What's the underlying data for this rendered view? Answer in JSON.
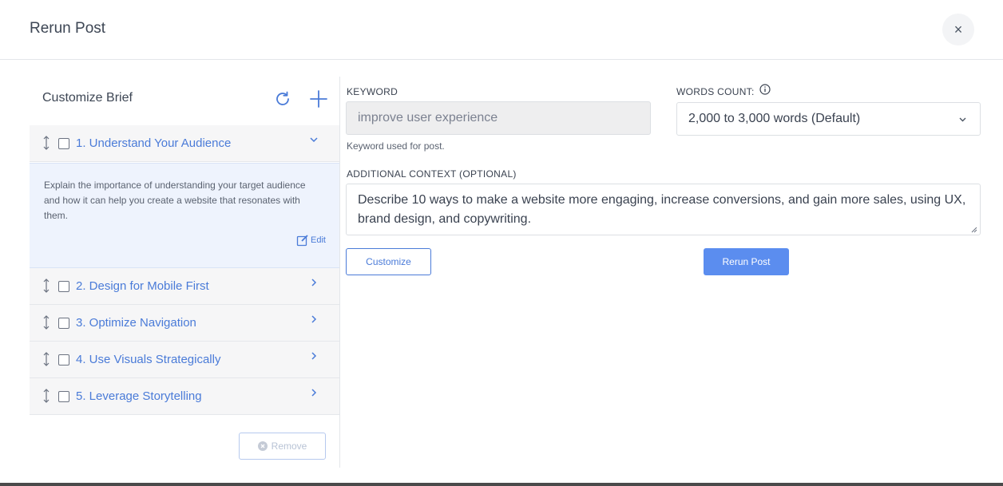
{
  "modal": {
    "title": "Rerun Post",
    "close_label": "×"
  },
  "brief": {
    "title": "Customize Brief",
    "items": [
      {
        "label": "1. Understand Your Audience",
        "expanded": true
      },
      {
        "label": "2. Design for Mobile First",
        "expanded": false
      },
      {
        "label": "3. Optimize Navigation",
        "expanded": false
      },
      {
        "label": "4. Use Visuals Strategically",
        "expanded": false
      },
      {
        "label": "5. Leverage Storytelling",
        "expanded": false
      }
    ],
    "detail_text": "Explain the importance of understanding your target audience and how it can help you create a website that resonates with them.",
    "edit_label": "Edit",
    "remove_label": "Remove"
  },
  "form": {
    "keyword_label": "KEYWORD",
    "keyword_value": "improve user experience",
    "keyword_help": "Keyword used for post.",
    "words_label": "WORDS COUNT:",
    "words_value": "2,000 to 3,000 words (Default)",
    "context_label": "ADDITIONAL CONTEXT (OPTIONAL)",
    "context_value": "Describe 10 ways to make a website more engaging, increase conversions, and gain more sales, using UX, brand design, and copywriting.",
    "customize_label": "Customize",
    "rerun_label": "Rerun Post"
  },
  "colors": {
    "accent": "#4a7bd8",
    "primary_button": "#5b8def",
    "expanded_bg": "#eef3fd"
  }
}
